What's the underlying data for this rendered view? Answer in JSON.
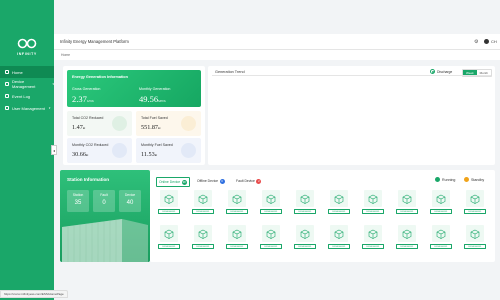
{
  "brand": {
    "name": "INFINITY",
    "color": "#1aa769"
  },
  "sidebar": {
    "items": [
      {
        "label": "Home",
        "active": true,
        "icon": "home-icon"
      },
      {
        "label": "Device Management",
        "active": false,
        "icon": "device-icon",
        "expandable": true
      },
      {
        "label": "Event Log",
        "active": false,
        "icon": "log-icon"
      },
      {
        "label": "User Management",
        "active": false,
        "icon": "user-icon",
        "expandable": true
      }
    ]
  },
  "header": {
    "title": "Infinity Energy Management Platform",
    "lang": "CH",
    "icon": "settings-icon"
  },
  "breadcrumb": "Home",
  "generation": {
    "title": "Energy Generation Information",
    "gross_label": "Gross Generation",
    "gross_value": "2.37",
    "gross_unit": "GWh",
    "monthly_label": "Monthly Generation",
    "monthly_value": "49.56",
    "monthly_unit": "MWh",
    "co2_total_label": "Total CO2 Reduced",
    "co2_total_value": "1.47",
    "co2_total_unit": "kt",
    "fuel_total_label": "Total Fuel Saved",
    "fuel_total_value": "551.87",
    "fuel_total_unit": "kt",
    "co2_month_label": "Monthly CO2 Reduced",
    "co2_month_value": "30.66",
    "co2_month_unit": "kt",
    "fuel_month_label": "Monthly Fuel Saved",
    "fuel_month_value": "11.53",
    "fuel_month_unit": "kt"
  },
  "trend": {
    "title": "Generation Trend",
    "radio_label": "Discharge",
    "seg_on": "Week",
    "seg_off": "Month"
  },
  "station": {
    "title": "Station Information",
    "station_label": "Station",
    "station_value": "35",
    "fault_label": "Fault",
    "fault_value": "0",
    "device_label": "Device",
    "device_value": "40"
  },
  "devices": {
    "tabs": [
      {
        "label": "Online Device",
        "count": "38",
        "color": "#1aa769",
        "active": true
      },
      {
        "label": "Offline Device",
        "count": "0",
        "color": "#2f6fe0",
        "active": false
      },
      {
        "label": "Fault Device",
        "count": "2",
        "color": "#e84b4b",
        "active": false
      }
    ],
    "legend": [
      {
        "label": "Running",
        "color": "#1aa769"
      },
      {
        "label": "Standby",
        "color": "#f0a31a"
      }
    ],
    "tag": "ESS0000001"
  },
  "status_url": "https://xxxxx.infinityess.com/ESS/HomePage"
}
